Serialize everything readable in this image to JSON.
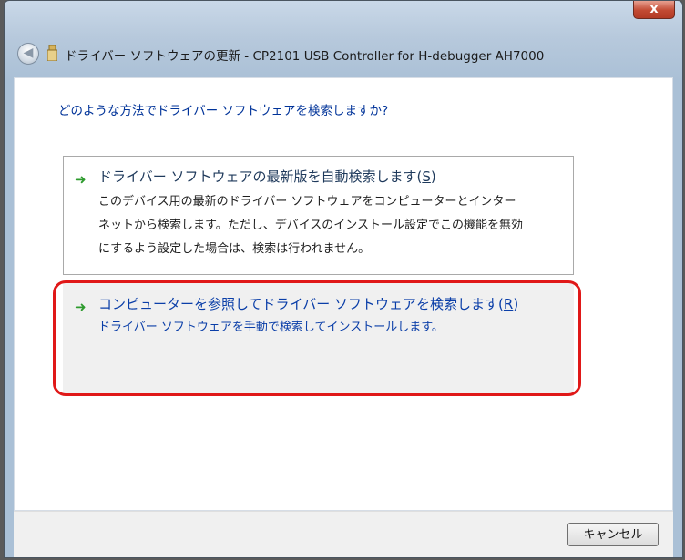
{
  "window": {
    "title": "ドライバー ソフトウェアの更新 - CP2101 USB Controller for H-debugger AH7000",
    "close_label": "x"
  },
  "question": "どのような方法でドライバー ソフトウェアを検索しますか?",
  "options": [
    {
      "title": "ドライバー ソフトウェアの最新版を自動検索します(",
      "hotkey": "S",
      "title_end": ")",
      "desc_lines": [
        "このデバイス用の最新のドライバー ソフトウェアをコンピューターとインター",
        "ネットから検索します。ただし、デバイスのインストール設定でこの機能を無効",
        "にするよう設定した場合は、検索は行われません。"
      ]
    },
    {
      "title": "コンピューターを参照してドライバー ソフトウェアを検索します(",
      "hotkey": "R",
      "title_end": ")",
      "desc_lines": [
        "ドライバー ソフトウェアを手動で検索してインストールします。"
      ]
    }
  ],
  "footer": {
    "cancel_label": "キャンセル"
  },
  "colors": {
    "highlight": "#e01818",
    "link": "#003399",
    "arrow": "#2e9b2e"
  }
}
